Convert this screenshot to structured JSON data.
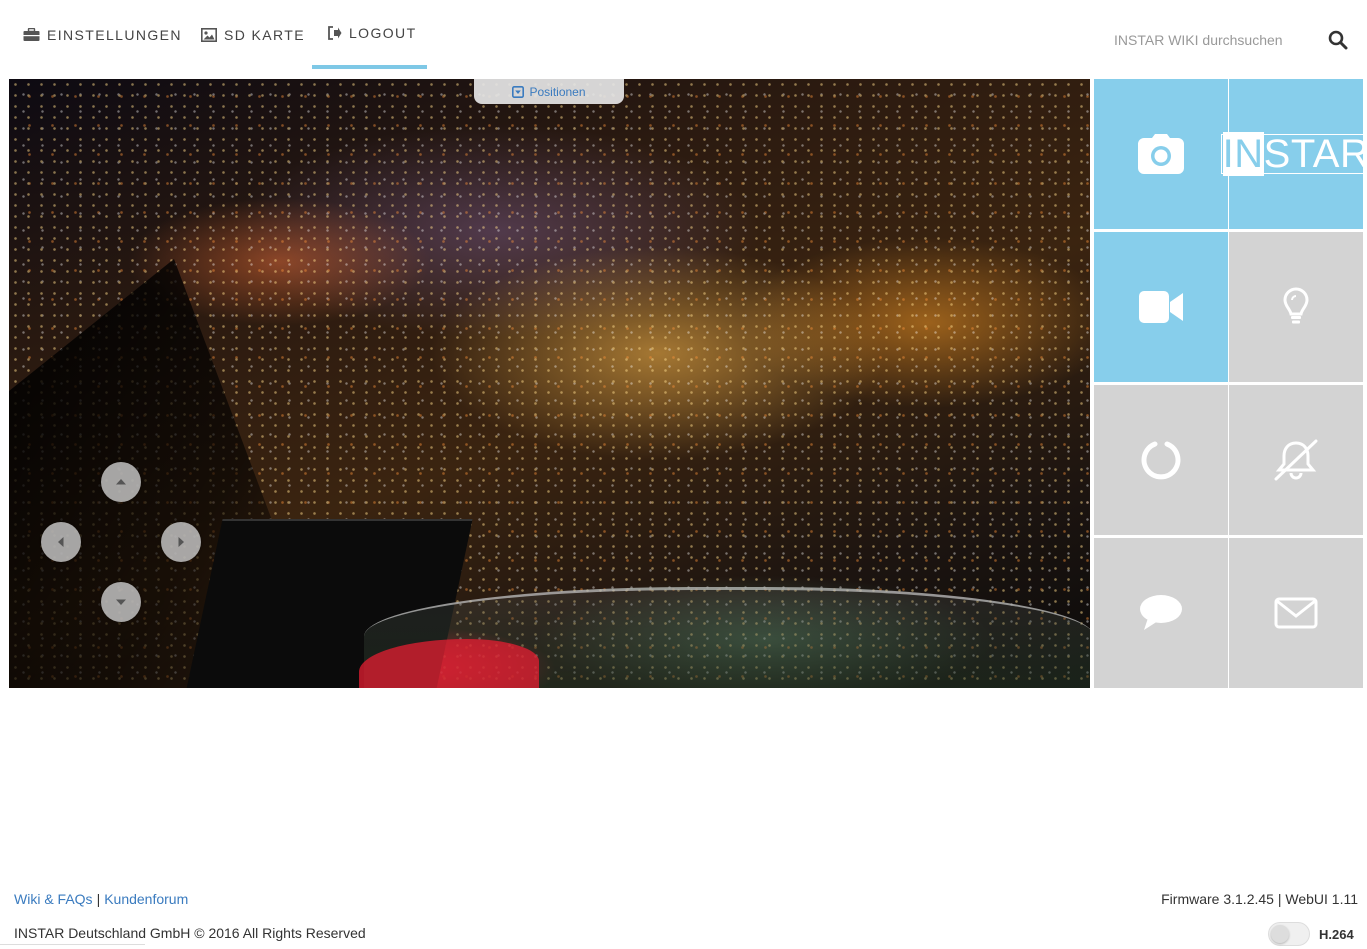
{
  "nav": {
    "items": [
      {
        "label": "EINSTELLUNGEN",
        "icon": "briefcase-icon"
      },
      {
        "label": "SD KARTE",
        "icon": "image-icon"
      },
      {
        "label": "LOGOUT",
        "icon": "sign-out-icon",
        "active": true
      }
    ],
    "search": {
      "placeholder": "INSTAR WIKI durchsuchen",
      "value": ""
    }
  },
  "video": {
    "positions_label": "Positionen"
  },
  "tiles": [
    {
      "icon": "camera-icon",
      "color": "#87ceeb"
    },
    {
      "icon": "instar-logo",
      "text_pre": "IN",
      "text_post": "STAR",
      "color": "#87ceeb"
    },
    {
      "icon": "video-camera-icon",
      "color": "#87ceeb"
    },
    {
      "icon": "lightbulb-icon",
      "color": "#d3d3d3"
    },
    {
      "icon": "circle-notch-icon",
      "color": "#d3d3d3"
    },
    {
      "icon": "bell-slash-icon",
      "color": "#d3d3d3"
    },
    {
      "icon": "comment-icon",
      "color": "#d3d3d3"
    },
    {
      "icon": "envelope-icon",
      "color": "#d3d3d3"
    }
  ],
  "footer": {
    "link_wiki": "Wiki & FAQs",
    "separator": "|",
    "link_forum": "Kundenforum",
    "copyright": "INSTAR Deutschland GmbH © 2016 All Rights Reserved",
    "versions": "Firmware 3.1.2.45 | WebUI 1.11",
    "codec": "H.264"
  },
  "colors": {
    "accent": "#87ceeb",
    "link": "#3a7bbf",
    "tile_gray": "#d3d3d3"
  }
}
